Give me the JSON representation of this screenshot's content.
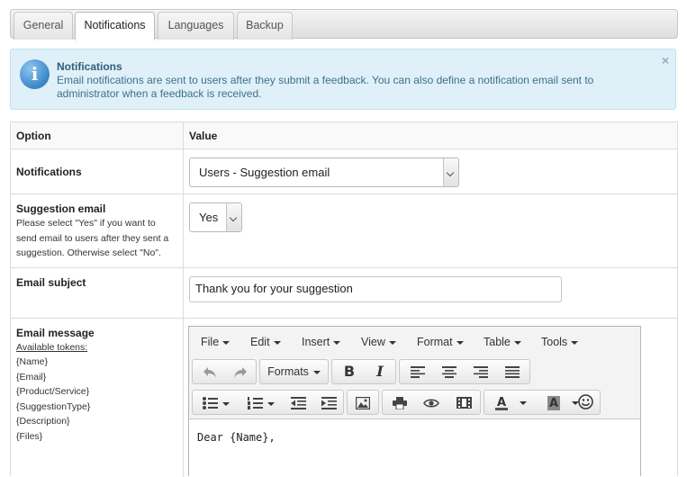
{
  "tabs": [
    "General",
    "Notifications",
    "Languages",
    "Backup"
  ],
  "info": {
    "title": "Notifications",
    "text": "Email notifications are sent to users after they submit a feedback. You can also define a notification email sent to administrator when a feedback is received.",
    "close": "×"
  },
  "table": {
    "header_option": "Option",
    "header_value": "Value",
    "notifications": {
      "label": "Notifications",
      "selected": "Users - Suggestion email"
    },
    "suggestion_email": {
      "label": "Suggestion email",
      "desc": [
        "Please select \"Yes\" if you want to",
        "send email to users after they sent a",
        "suggestion. Otherwise select \"No\"."
      ],
      "selected": "Yes"
    },
    "email_subject": {
      "label": "Email subject",
      "value": "Thank you for your suggestion"
    },
    "email_message": {
      "label": "Email message",
      "tokens_label": "Available tokens:",
      "tokens": [
        "{Name}",
        "{Email}",
        "{Product/Service}",
        "{SuggestionType}",
        "{Description}",
        "{Files}"
      ]
    }
  },
  "editor": {
    "menus": [
      "File",
      "Edit",
      "Insert",
      "View",
      "Format",
      "Table",
      "Tools"
    ],
    "formats_label": "Formats",
    "content": "Dear {Name},",
    "icons": [
      "undo-icon",
      "redo-icon",
      "bold-icon",
      "italic-icon",
      "align-left-icon",
      "align-center-icon",
      "align-right-icon",
      "align-justify-icon",
      "bullet-list-icon",
      "numbered-list-icon",
      "outdent-icon",
      "indent-icon",
      "image-icon",
      "print-icon",
      "preview-icon",
      "media-icon",
      "text-color-icon",
      "background-color-icon",
      "emoticon-icon"
    ]
  }
}
